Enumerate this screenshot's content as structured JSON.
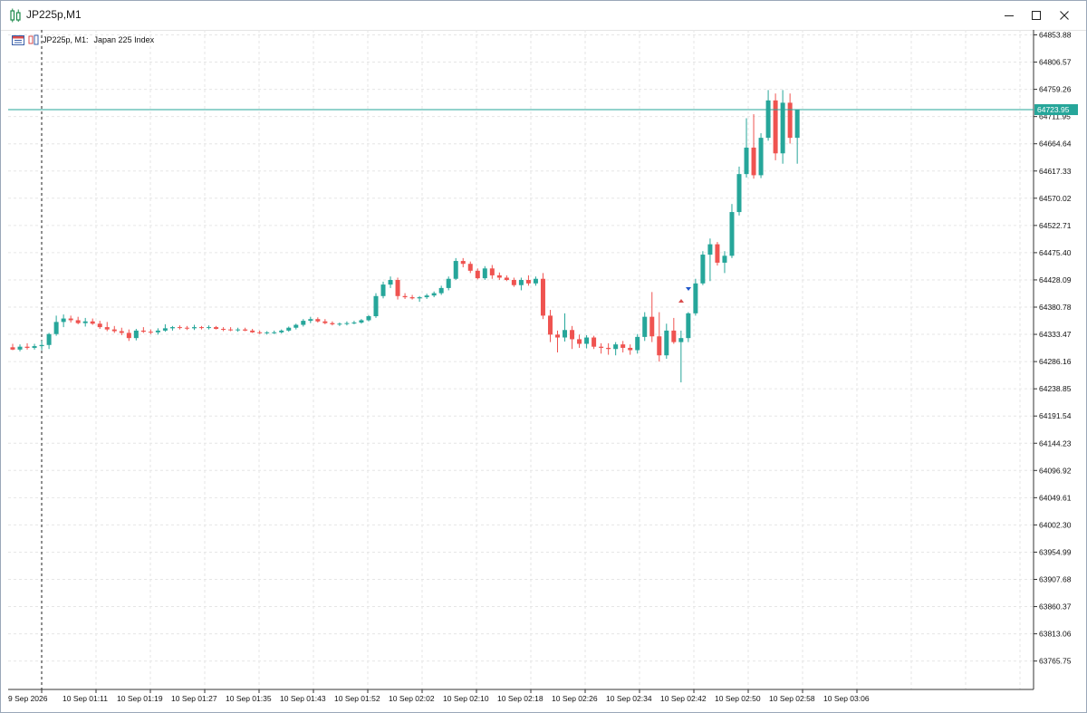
{
  "window": {
    "title": "JP225p,M1",
    "minimize_icon": "minimize-icon",
    "maximize_icon": "maximize-icon",
    "close_icon": "close-icon"
  },
  "chart_header": {
    "symbol_timeframe": "JP225p, M1:",
    "description": "Japan 225 Index",
    "icons": [
      "trade-list-icon",
      "chart-window-icon"
    ]
  },
  "colors": {
    "bull": "#26a69a",
    "bear": "#ef5350",
    "grid": "#e6e6e6",
    "price_line": "#26a69a",
    "axis_text": "#111111"
  },
  "current_price": "64723.95",
  "chart_data": {
    "type": "candlestick",
    "y_axis_labels": [
      "64853.88",
      "64806.57",
      "64759.26",
      "64711.95",
      "64664.64",
      "64617.33",
      "64570.02",
      "64522.71",
      "64475.40",
      "64428.09",
      "64380.78",
      "64333.47",
      "64286.16",
      "64238.85",
      "64191.54",
      "64144.23",
      "64096.92",
      "64049.61",
      "64002.30",
      "63954.99",
      "63907.68",
      "63860.37",
      "63813.06",
      "63765.75"
    ],
    "x_axis_labels": [
      "9 Sep 2026",
      "10 Sep 01:11",
      "10 Sep 01:19",
      "10 Sep 01:27",
      "10 Sep 01:35",
      "10 Sep 01:43",
      "10 Sep 01:52",
      "10 Sep 02:02",
      "10 Sep 02:10",
      "10 Sep 02:18",
      "10 Sep 02:26",
      "10 Sep 02:34",
      "10 Sep 02:42",
      "10 Sep 02:50",
      "10 Sep 02:58",
      "10 Sep 03:06"
    ],
    "ylim": [
      63745,
      64870
    ],
    "candles": [
      [
        64311,
        64317,
        64306,
        64307
      ],
      [
        64307,
        64316,
        64304,
        64312
      ],
      [
        64312,
        64318,
        64307,
        64310
      ],
      [
        64310,
        64317,
        64307,
        64313
      ],
      [
        64313,
        64323,
        64306,
        64315
      ],
      [
        64315,
        64336,
        64308,
        64334
      ],
      [
        64334,
        64366,
        64331,
        64355
      ],
      [
        64355,
        64368,
        64346,
        64361
      ],
      [
        64361,
        64366,
        64354,
        64358
      ],
      [
        64358,
        64364,
        64351,
        64353
      ],
      [
        64353,
        64362,
        64347,
        64356
      ],
      [
        64356,
        64361,
        64350,
        64352
      ],
      [
        64352,
        64357,
        64343,
        64346
      ],
      [
        64346,
        64355,
        64339,
        64342
      ],
      [
        64342,
        64348,
        64336,
        64339
      ],
      [
        64339,
        64345,
        64332,
        64336
      ],
      [
        64336,
        64342,
        64322,
        64327
      ],
      [
        64327,
        64343,
        64323,
        64340
      ],
      [
        64340,
        64346,
        64336,
        64338
      ],
      [
        64338,
        64342,
        64334,
        64337
      ],
      [
        64337,
        64344,
        64333,
        64340
      ],
      [
        64340,
        64351,
        64338,
        64344
      ],
      [
        64344,
        64348,
        64340,
        64346
      ],
      [
        64346,
        64349,
        64342,
        64345
      ],
      [
        64345,
        64348,
        64341,
        64344
      ],
      [
        64344,
        64350,
        64341,
        64346
      ],
      [
        64346,
        64348,
        64342,
        64345
      ],
      [
        64345,
        64349,
        64342,
        64346
      ],
      [
        64346,
        64348,
        64342,
        64343
      ],
      [
        64343,
        64346,
        64339,
        64342
      ],
      [
        64342,
        64346,
        64339,
        64341
      ],
      [
        64341,
        64345,
        64338,
        64342
      ],
      [
        64342,
        64345,
        64339,
        64340
      ],
      [
        64340,
        64343,
        64336,
        64337
      ],
      [
        64337,
        64340,
        64334,
        64336
      ],
      [
        64336,
        64339,
        64333,
        64337
      ],
      [
        64337,
        64340,
        64334,
        64337
      ],
      [
        64337,
        64342,
        64335,
        64340
      ],
      [
        64340,
        64347,
        64338,
        64345
      ],
      [
        64345,
        64352,
        64342,
        64350
      ],
      [
        64350,
        64360,
        64347,
        64357
      ],
      [
        64357,
        64364,
        64353,
        64360
      ],
      [
        64360,
        64363,
        64354,
        64356
      ],
      [
        64356,
        64360,
        64351,
        64353
      ],
      [
        64353,
        64356,
        64349,
        64351
      ],
      [
        64351,
        64354,
        64348,
        64352
      ],
      [
        64352,
        64356,
        64349,
        64353
      ],
      [
        64353,
        64357,
        64351,
        64354
      ],
      [
        64354,
        64360,
        64352,
        64358
      ],
      [
        64358,
        64367,
        64356,
        64365
      ],
      [
        64365,
        64405,
        64362,
        64400
      ],
      [
        64400,
        64425,
        64396,
        64420
      ],
      [
        64420,
        64434,
        64414,
        64428
      ],
      [
        64428,
        64432,
        64394,
        64400
      ],
      [
        64400,
        64405,
        64395,
        64398
      ],
      [
        64398,
        64402,
        64394,
        64396
      ],
      [
        64396,
        64400,
        64390,
        64398
      ],
      [
        64398,
        64404,
        64395,
        64401
      ],
      [
        64401,
        64408,
        64398,
        64405
      ],
      [
        64405,
        64418,
        64402,
        64414
      ],
      [
        64414,
        64434,
        64410,
        64430
      ],
      [
        64430,
        64466,
        64428,
        64461
      ],
      [
        64461,
        64466,
        64450,
        64456
      ],
      [
        64456,
        64460,
        64440,
        64444
      ],
      [
        64444,
        64448,
        64429,
        64431
      ],
      [
        64431,
        64452,
        64428,
        64448
      ],
      [
        64448,
        64454,
        64430,
        64436
      ],
      [
        64436,
        64441,
        64428,
        64432
      ],
      [
        64432,
        64436,
        64426,
        64428
      ],
      [
        64428,
        64432,
        64416,
        64419
      ],
      [
        64419,
        64432,
        64410,
        64428
      ],
      [
        64428,
        64436,
        64418,
        64422
      ],
      [
        64422,
        64434,
        64418,
        64430
      ],
      [
        64430,
        64440,
        64360,
        64366
      ],
      [
        64366,
        64376,
        64320,
        64333
      ],
      [
        64333,
        64340,
        64302,
        64328
      ],
      [
        64328,
        64370,
        64321,
        64341
      ],
      [
        64341,
        64348,
        64308,
        64325
      ],
      [
        64325,
        64333,
        64310,
        64317
      ],
      [
        64317,
        64332,
        64309,
        64328
      ],
      [
        64328,
        64331,
        64308,
        64312
      ],
      [
        64312,
        64318,
        64300,
        64310
      ],
      [
        64310,
        64318,
        64298,
        64308
      ],
      [
        64308,
        64320,
        64297,
        64316
      ],
      [
        64316,
        64322,
        64302,
        64310
      ],
      [
        64310,
        64316,
        64298,
        64306
      ],
      [
        64306,
        64334,
        64300,
        64329
      ],
      [
        64329,
        64372,
        64322,
        64364
      ],
      [
        64364,
        64407,
        64320,
        64330
      ],
      [
        64330,
        64372,
        64286,
        64297
      ],
      [
        64297,
        64352,
        64291,
        64340
      ],
      [
        64340,
        64362,
        64317,
        64320
      ],
      [
        64320,
        64340,
        64250,
        64327
      ],
      [
        64327,
        64372,
        64320,
        64370
      ],
      [
        64370,
        64430,
        64366,
        64422
      ],
      [
        64422,
        64478,
        64419,
        64472
      ],
      [
        64472,
        64500,
        64426,
        64490
      ],
      [
        64490,
        64494,
        64453,
        64458
      ],
      [
        64458,
        64478,
        64440,
        64470
      ],
      [
        64470,
        64560,
        64466,
        64546
      ],
      [
        64546,
        64625,
        64540,
        64612
      ],
      [
        64612,
        64709,
        64606,
        64658
      ],
      [
        64658,
        64716,
        64604,
        64610
      ],
      [
        64610,
        64683,
        64605,
        64675
      ],
      [
        64675,
        64758,
        64670,
        64740
      ],
      [
        64740,
        64752,
        64636,
        64648
      ],
      [
        64648,
        64758,
        64630,
        64736
      ],
      [
        64736,
        64752,
        64665,
        64675
      ],
      [
        64675,
        64720,
        64630,
        64724
      ]
    ]
  }
}
